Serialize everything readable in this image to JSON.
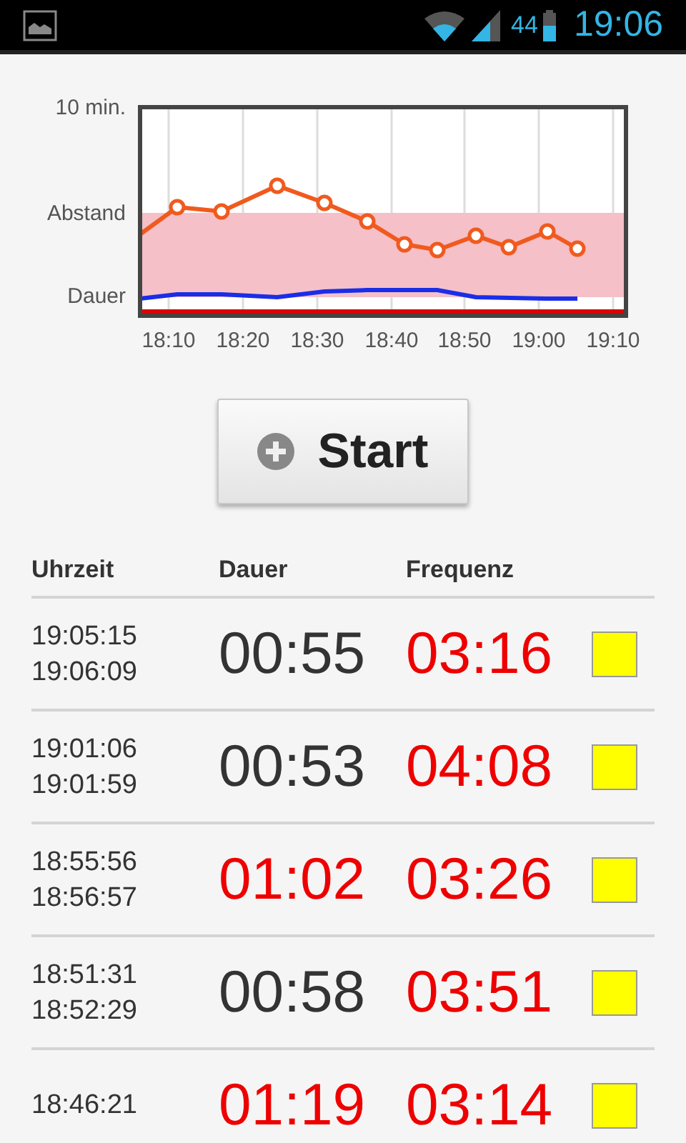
{
  "status_bar": {
    "battery": "44",
    "time": "19:06"
  },
  "chart": {
    "y_labels": [
      "10 min.",
      "Abstand",
      "Dauer"
    ],
    "x_labels": [
      "18:10",
      "18:20",
      "18:30",
      "18:40",
      "18:50",
      "19:00",
      "19:10"
    ]
  },
  "start_button": {
    "label": "Start"
  },
  "table": {
    "columns": [
      "Uhrzeit",
      "Dauer",
      "Frequenz"
    ],
    "rows": [
      {
        "start": "19:05:15",
        "end": "19:06:09",
        "dauer": {
          "text": "00:55",
          "alert": false
        },
        "frequenz": {
          "text": "03:16",
          "alert": true
        },
        "color": "#ffff00"
      },
      {
        "start": "19:01:06",
        "end": "19:01:59",
        "dauer": {
          "text": "00:53",
          "alert": false
        },
        "frequenz": {
          "text": "04:08",
          "alert": true
        },
        "color": "#ffff00"
      },
      {
        "start": "18:55:56",
        "end": "18:56:57",
        "dauer": {
          "text": "01:02",
          "alert": true
        },
        "frequenz": {
          "text": "03:26",
          "alert": true
        },
        "color": "#ffff00"
      },
      {
        "start": "18:51:31",
        "end": "18:52:29",
        "dauer": {
          "text": "00:58",
          "alert": false
        },
        "frequenz": {
          "text": "03:51",
          "alert": true
        },
        "color": "#ffff00"
      },
      {
        "start": "18:46:21",
        "dauer": {
          "text": "01:19",
          "alert": true
        },
        "frequenz": {
          "text": "03:14",
          "alert": true
        },
        "color": "#ffff00"
      }
    ]
  }
}
